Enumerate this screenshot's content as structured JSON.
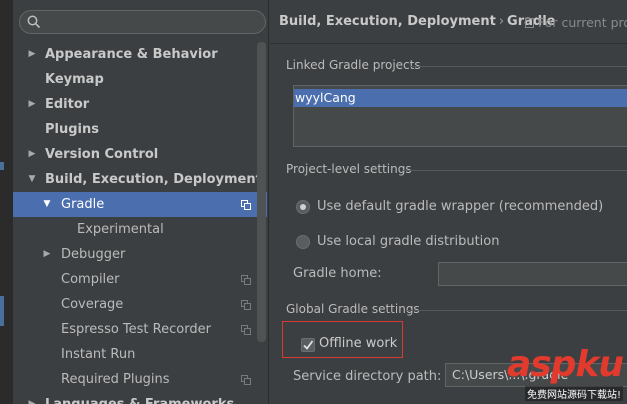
{
  "sidebar": {
    "search_placeholder": "",
    "items": [
      {
        "label": "Appearance & Behavior",
        "arrow": "▶"
      },
      {
        "label": "Keymap",
        "arrow": ""
      },
      {
        "label": "Editor",
        "arrow": "▶"
      },
      {
        "label": "Plugins",
        "arrow": ""
      },
      {
        "label": "Version Control",
        "arrow": "▶"
      },
      {
        "label": "Build, Execution, Deployment",
        "arrow": "▼"
      },
      {
        "label": "Gradle",
        "arrow": "▼"
      },
      {
        "label": "Experimental",
        "arrow": ""
      },
      {
        "label": "Debugger",
        "arrow": "▶"
      },
      {
        "label": "Compiler",
        "arrow": ""
      },
      {
        "label": "Coverage",
        "arrow": ""
      },
      {
        "label": "Espresso Test Recorder",
        "arrow": ""
      },
      {
        "label": "Instant Run",
        "arrow": ""
      },
      {
        "label": "Required Plugins",
        "arrow": ""
      },
      {
        "label": "Languages & Frameworks",
        "arrow": "▶"
      }
    ]
  },
  "header": {
    "crumb1": "Build, Execution, Deployment",
    "separator": "›",
    "crumb2": "Gradle",
    "scope": "For current proj"
  },
  "linked": {
    "title": "Linked Gradle projects",
    "selected_project": "wyylCang"
  },
  "project_level": {
    "title": "Project-level settings",
    "option_wrapper": "Use default gradle wrapper (recommended)",
    "option_local": "Use local gradle distribution",
    "gradle_home_label": "Gradle home:",
    "gradle_home_value": ""
  },
  "global": {
    "title": "Global Gradle settings",
    "offline_label": "Offline work",
    "offline_checked": true,
    "service_dir_label": "Service directory path:",
    "service_dir_value": "C:\\Users\\...\\.gradle"
  },
  "watermark": {
    "brand": "aspku",
    "tagline": "免费网站源码下载站!"
  },
  "colors": {
    "background": "#3c3f41",
    "selection": "#4b6eaf",
    "highlight_border": "#d9392f",
    "watermark": "#e23b2e"
  }
}
